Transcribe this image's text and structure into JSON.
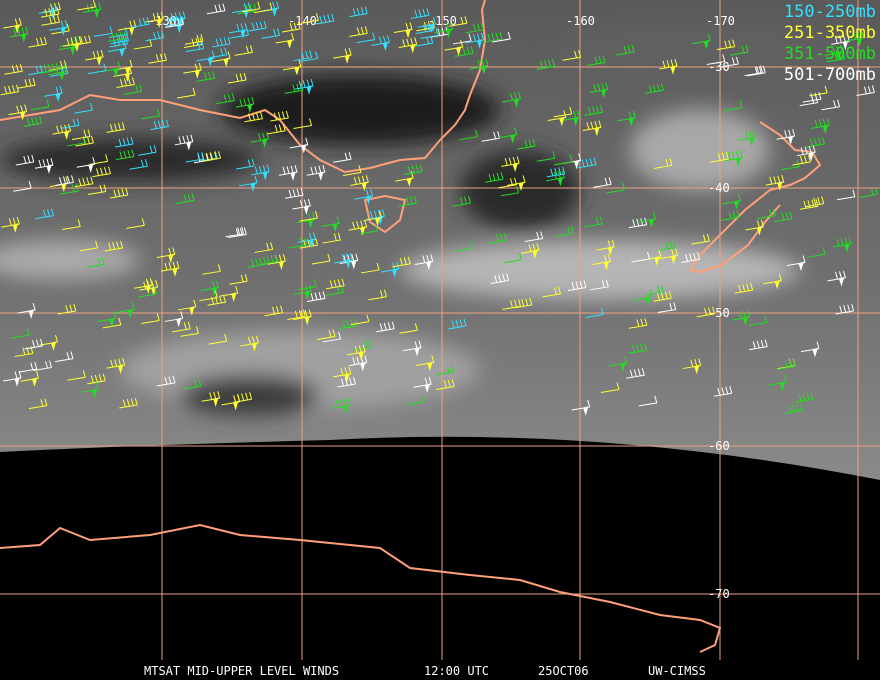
{
  "title": "MTSAT MID-UPPER LEVEL WINDS",
  "time": "12:00 UTC",
  "date": "25OCT06",
  "source": "UW-CIMSS",
  "legend": [
    {
      "label": "150-250mb",
      "color": "#33e0ff"
    },
    {
      "label": "251-350mb",
      "color": "#ffff33"
    },
    {
      "label": "351-500mb",
      "color": "#22dd22"
    },
    {
      "label": "501-700mb",
      "color": "#ffffff"
    }
  ],
  "grid_color": "#f0a080",
  "coast_color": "#ffa07a",
  "longitude_labels": [
    "-130",
    "-140",
    "-150",
    "-160",
    "-170"
  ],
  "latitude_labels": [
    "-30",
    "-40",
    "-50",
    "-60",
    "-70"
  ]
}
